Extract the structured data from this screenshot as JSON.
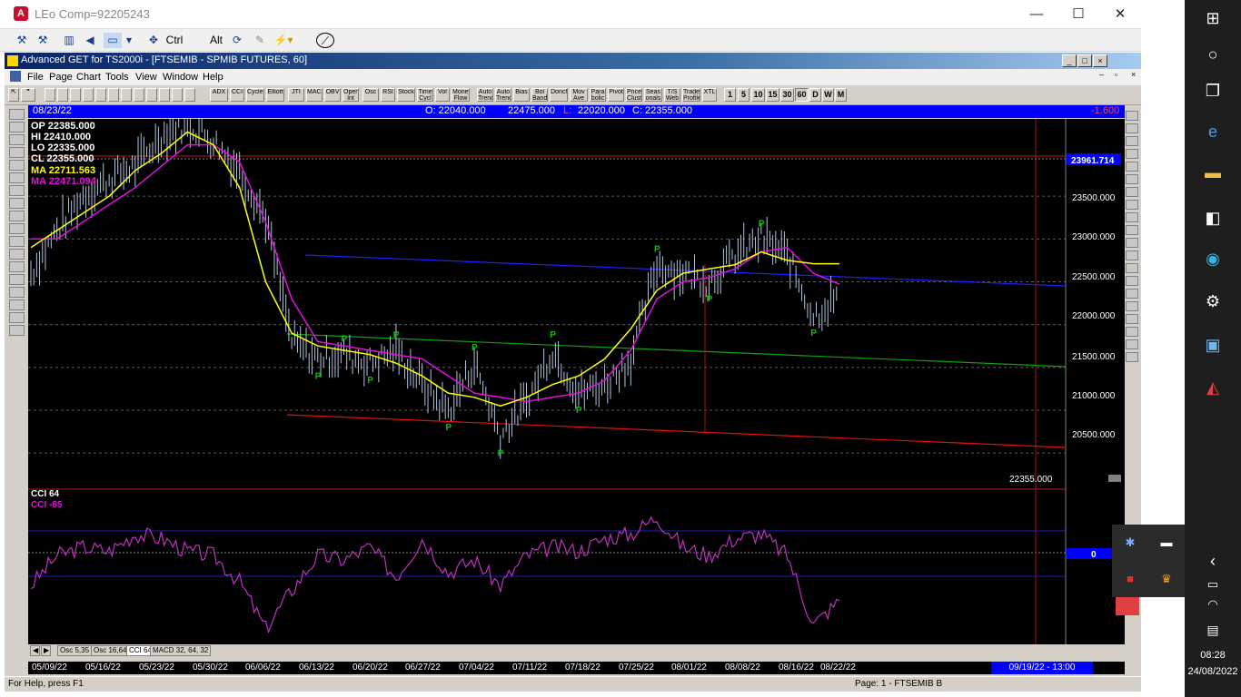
{
  "outer_window": {
    "title": "LEo Comp=92205243",
    "app_icon": "A",
    "minimize": "—",
    "maximize": "☐",
    "close": "✕"
  },
  "toolbar1": {
    "ctrl_label": "Ctrl",
    "alt_label": "Alt"
  },
  "mdi_window": {
    "title": "Advanced GET for TS2000i - [FTSEMIB - SPMIB FUTURES, 60]"
  },
  "menu": [
    "File",
    "Page",
    "Chart",
    "Tools",
    "View",
    "Window",
    "Help"
  ],
  "toolbar2": {
    "studies": [
      "ADX",
      "CCI",
      "Cycles",
      "Elliott",
      "JTI",
      "MACD",
      "OBV",
      "Open Int",
      "Osc",
      "RSI",
      "Stock",
      "Time Cycl",
      "Vol",
      "Money Flow",
      "Auto Trend",
      "Auto Trend",
      "Bias",
      "Bol Band",
      "Donch",
      "Mov Ave",
      "Para bolic",
      "Pivot",
      "Price Clust",
      "Seas onals",
      "T/S Web",
      "Trade Profile",
      "XTL"
    ],
    "timeframes": [
      "1",
      "5",
      "10",
      "15",
      "30",
      "60",
      "D",
      "W",
      "M"
    ]
  },
  "ohlc_header": {
    "date": "08/23/22",
    "open": "O: 22040.000",
    "high": "22475.000",
    "low_label": "L:",
    "low": "22020.000",
    "close": "C: 22355.000",
    "change": "-1.600"
  },
  "legend": {
    "op": "OP  22385.000",
    "hi": "HI   22410.000",
    "lo": "LO  22335.000",
    "cl": "CL  22355.000",
    "ma1": "MA  22711.563",
    "ma2": "MA  22471.094"
  },
  "price_axis": {
    "highlight": "23961.714",
    "ticks": [
      "23500.000",
      "23000.000",
      "22500.000",
      "22000.000",
      "21500.000",
      "21000.000",
      "20500.000"
    ],
    "current": "22355.000"
  },
  "cci_legend": {
    "title": "CCI 64",
    "value": "CCI  -85",
    "zero_label": "0"
  },
  "osc_tabs": [
    "Osc 5,35",
    "Osc 16,64",
    "CCI 64",
    "MACD 32, 64, 32"
  ],
  "date_axis": {
    "labels": [
      "05/09/22",
      "05/16/22",
      "05/23/22",
      "05/30/22",
      "06/06/22",
      "06/13/22",
      "06/20/22",
      "06/27/22",
      "07/04/22",
      "07/11/22",
      "07/18/22",
      "07/25/22",
      "08/01/22",
      "08/08/22",
      "08/16/22",
      "08/22/22"
    ],
    "future": "09/19/22 - 13:00"
  },
  "status": {
    "help": "For Help, press F1",
    "page": "Page: 1 - FTSEMIB B"
  },
  "pivot_marker": "P",
  "clock": {
    "time": "08:28",
    "date": "24/08/2022"
  },
  "colors": {
    "chart_bg": "#000000",
    "price_bars": "#b0c4de",
    "ma_fast": "#ffff00",
    "ma_slow": "#e010e0",
    "cci_line": "#c030c0",
    "trend_blue": "#2020ff",
    "trend_green": "#10a010",
    "trend_red": "#e01010",
    "pivot": "#10c010"
  },
  "chart_data": {
    "type": "line",
    "x": [
      "05/09/22",
      "05/12/22",
      "05/16/22",
      "05/19/22",
      "05/23/22",
      "05/26/22",
      "05/30/22",
      "06/02/22",
      "06/06/22",
      "06/09/22",
      "06/13/22",
      "06/16/22",
      "06/20/22",
      "06/23/22",
      "06/27/22",
      "06/30/22",
      "07/04/22",
      "07/07/22",
      "07/11/22",
      "07/14/22",
      "07/18/22",
      "07/21/22",
      "07/25/22",
      "07/28/22",
      "08/01/22",
      "08/04/22",
      "08/08/22",
      "08/11/22",
      "08/16/22",
      "08/18/22",
      "08/22/22",
      "08/23/22"
    ],
    "series": [
      {
        "name": "price",
        "values": [
          22600,
          23100,
          23500,
          23700,
          23850,
          24200,
          24350,
          24150,
          23800,
          23250,
          21800,
          21600,
          21650,
          21550,
          21700,
          21300,
          21000,
          21550,
          20700,
          21100,
          21700,
          21200,
          21300,
          21600,
          22700,
          22600,
          22500,
          22800,
          23000,
          22800,
          22100,
          22355
        ]
      },
      {
        "name": "ma_fast",
        "values": [
          22900,
          23100,
          23300,
          23500,
          23800,
          24000,
          24250,
          24100,
          23600,
          22500,
          21900,
          21750,
          21700,
          21650,
          21550,
          21400,
          21200,
          21150,
          21050,
          21150,
          21300,
          21400,
          21600,
          21950,
          22400,
          22600,
          22650,
          22700,
          22850,
          22750,
          22711,
          22711
        ]
      },
      {
        "name": "ma_slow",
        "values": [
          23000,
          23000,
          23200,
          23400,
          23600,
          23850,
          24100,
          24100,
          23900,
          23200,
          22300,
          21800,
          21750,
          21700,
          21650,
          21600,
          21400,
          21200,
          21150,
          21100,
          21150,
          21200,
          21350,
          21700,
          22300,
          22500,
          22550,
          22650,
          22850,
          22900,
          22600,
          22471
        ]
      },
      {
        "name": "cci",
        "values": [
          -50,
          20,
          40,
          30,
          70,
          60,
          30,
          20,
          -40,
          -150,
          -60,
          20,
          10,
          40,
          -30,
          60,
          -20,
          10,
          -50,
          20,
          40,
          30,
          60,
          70,
          110,
          40,
          20,
          60,
          70,
          20,
          -140,
          -85
        ]
      }
    ],
    "ylim": [
      20300,
      24350
    ],
    "cci_ylim": [
      -180,
      170
    ]
  }
}
